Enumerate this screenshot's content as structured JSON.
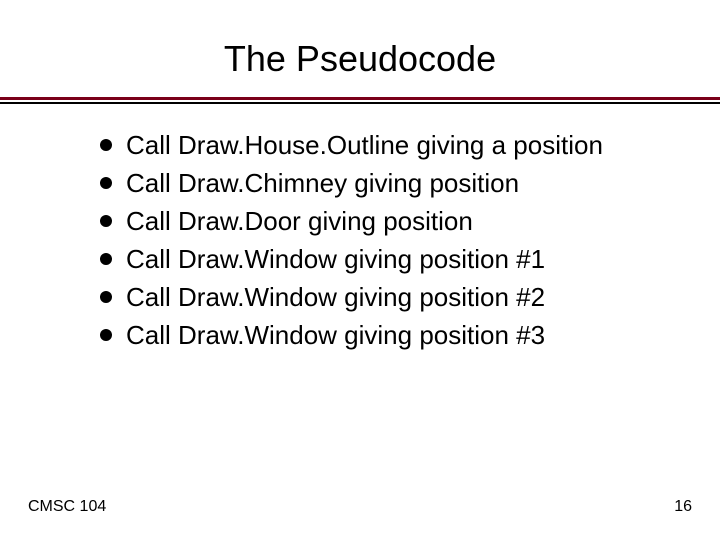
{
  "title": "The Pseudocode",
  "bullets": [
    "Call Draw.House.Outline giving a position",
    "Call Draw.Chimney giving position",
    "Call Draw.Door giving position",
    "Call Draw.Window giving position #1",
    "Call Draw.Window giving position #2",
    "Call Draw.Window giving position #3"
  ],
  "footer": {
    "left": "CMSC 104",
    "right": "16"
  }
}
